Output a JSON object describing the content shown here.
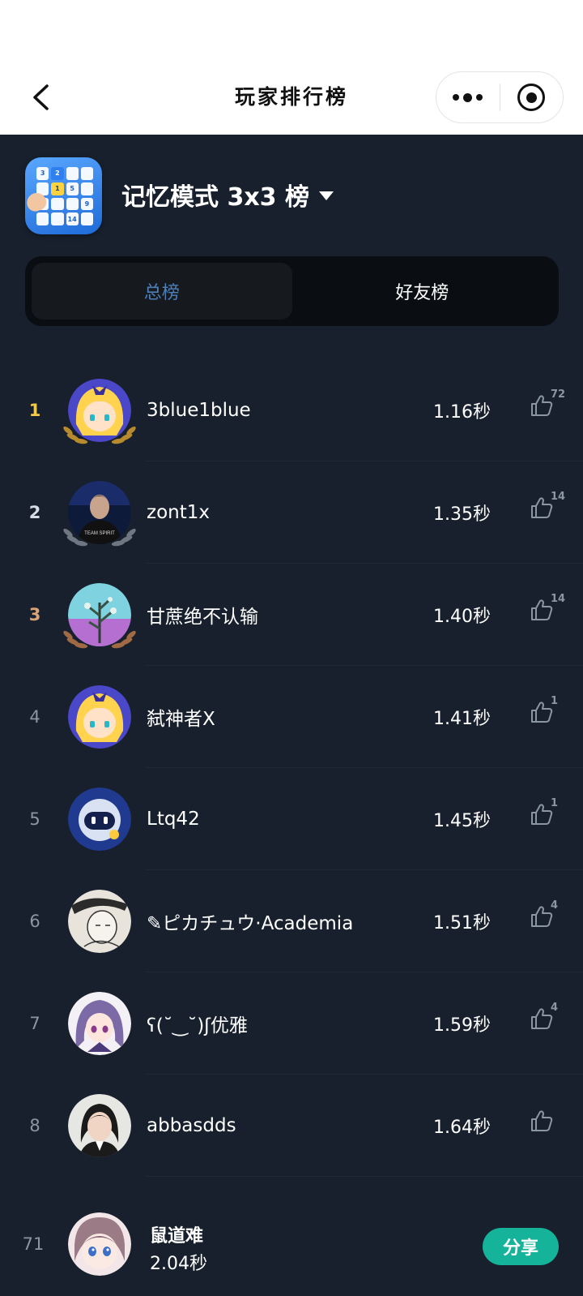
{
  "header": {
    "title": "玩家排行榜",
    "back_icon": "chevron-left-icon",
    "more_icon": "more-dots-icon",
    "close_icon": "target-close-icon"
  },
  "game": {
    "icon": "memory-grid-icon",
    "icon_cells": [
      "3",
      "2",
      "",
      "",
      "",
      "1",
      "5",
      "",
      "",
      "",
      "",
      "9",
      "",
      "",
      "14",
      ""
    ],
    "mode_title": "记忆模式 3x3 榜",
    "dropdown_icon": "caret-down-icon"
  },
  "tabs": [
    {
      "label": "总榜",
      "active": true
    },
    {
      "label": "好友榜",
      "active": false
    }
  ],
  "ranking": [
    {
      "rank": "1",
      "name": "3blue1blue",
      "score": "1.16秒",
      "likes": "72",
      "avatar": "anime-blonde-girl-avatar",
      "medal": "gold"
    },
    {
      "rank": "2",
      "name": "zont1x",
      "score": "1.35秒",
      "likes": "14",
      "avatar": "player-photo-avatar",
      "medal": "silver"
    },
    {
      "rank": "3",
      "name": "甘蔗绝不认输",
      "score": "1.40秒",
      "likes": "14",
      "avatar": "plant-art-avatar",
      "medal": "bronze"
    },
    {
      "rank": "4",
      "name": "弑神者X",
      "score": "1.41秒",
      "likes": "1",
      "avatar": "anime-blonde-girl-avatar",
      "medal": ""
    },
    {
      "rank": "5",
      "name": "Ltq42",
      "score": "1.45秒",
      "likes": "1",
      "avatar": "robot-avatar",
      "medal": ""
    },
    {
      "rank": "6",
      "name": "✎ピカチュウ·Academia",
      "score": "1.51秒",
      "likes": "4",
      "avatar": "sketch-avatar",
      "medal": ""
    },
    {
      "rank": "7",
      "name": "ʕ(˘‿˘)ʃ优雅",
      "score": "1.59秒",
      "likes": "4",
      "avatar": "anime-purple-hair-avatar",
      "medal": ""
    },
    {
      "rank": "8",
      "name": "abbasdds",
      "score": "1.64秒",
      "likes": "",
      "avatar": "portrait-photo-avatar",
      "medal": ""
    }
  ],
  "me": {
    "rank": "71",
    "name": "鼠道难",
    "score": "2.04秒",
    "avatar": "anime-girl-avatar",
    "share_label": "分享"
  },
  "colors": {
    "background": "#17202c",
    "tab_active_text": "#4d7fb8",
    "gold": "#f2c94c",
    "silver": "#d7dde4",
    "bronze": "#d9a47a",
    "share_button": "#14b39a"
  }
}
